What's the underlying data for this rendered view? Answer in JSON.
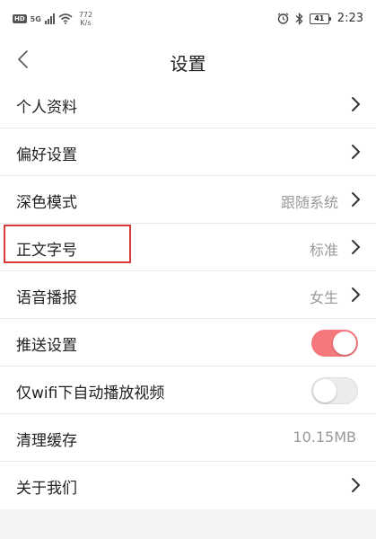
{
  "status_bar": {
    "hd_badge": "HD",
    "network": "5G",
    "speed_value": "772",
    "speed_unit": "K/s",
    "battery_level": "41",
    "time": "2:23"
  },
  "header": {
    "title": "设置"
  },
  "settings": [
    {
      "label": "个人资料",
      "value": "",
      "control": "chevron"
    },
    {
      "label": "偏好设置",
      "value": "",
      "control": "chevron"
    },
    {
      "label": "深色模式",
      "value": "跟随系统",
      "control": "chevron"
    },
    {
      "label": "正文字号",
      "value": "标准",
      "control": "chevron"
    },
    {
      "label": "语音播报",
      "value": "女生",
      "control": "chevron"
    },
    {
      "label": "推送设置",
      "value": "",
      "control": "toggle",
      "toggle_on": true
    },
    {
      "label": "仅wifi下自动播放视频",
      "value": "",
      "control": "toggle",
      "toggle_on": false
    },
    {
      "label": "清理缓存",
      "value": "10.15MB",
      "control": "none"
    },
    {
      "label": "关于我们",
      "value": "",
      "control": "chevron"
    }
  ],
  "colors": {
    "toggle_on": "#f4787c",
    "highlight": "#d63b37"
  },
  "icons": {
    "back": "chevron-left-icon",
    "row_arrow": "chevron-right-icon",
    "alarm": "alarm-icon",
    "bluetooth": "bluetooth-icon",
    "wifi": "wifi-icon",
    "signal": "signal-icon",
    "battery": "battery-icon"
  }
}
